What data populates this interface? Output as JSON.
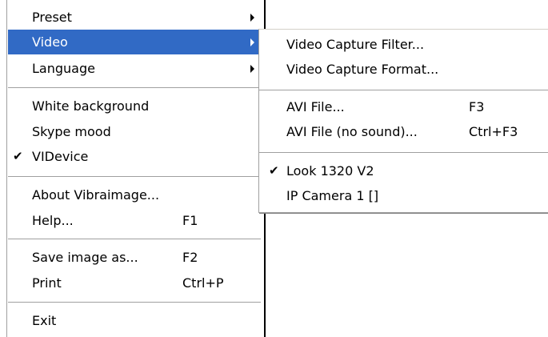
{
  "main_menu": {
    "items": [
      {
        "label": "Preset",
        "shortcut": "",
        "submenu": true
      },
      {
        "label": "Video",
        "shortcut": "",
        "submenu": true,
        "selected": true
      },
      {
        "label": "Language",
        "shortcut": "",
        "submenu": true
      },
      {
        "label": "White background",
        "shortcut": ""
      },
      {
        "label": "Skype mood",
        "shortcut": ""
      },
      {
        "label": "VIDevice",
        "shortcut": "",
        "checked": true
      },
      {
        "label": "About Vibraimage...",
        "shortcut": ""
      },
      {
        "label": "Help...",
        "shortcut": "F1"
      },
      {
        "label": "Save image as...",
        "shortcut": "F2"
      },
      {
        "label": "Print",
        "shortcut": "Ctrl+P"
      },
      {
        "label": "Exit",
        "shortcut": ""
      }
    ]
  },
  "sub_menu": {
    "items": [
      {
        "label": "Video Capture Filter...",
        "shortcut": ""
      },
      {
        "label": "Video Capture Format...",
        "shortcut": ""
      },
      {
        "label": "AVI File...",
        "shortcut": "F3"
      },
      {
        "label": "AVI File (no sound)...",
        "shortcut": "Ctrl+F3"
      },
      {
        "label": "Look 1320 V2",
        "shortcut": "",
        "checked": true
      },
      {
        "label": "IP Camera 1 []",
        "shortcut": ""
      }
    ]
  },
  "check_glyph": "✔",
  "colors": {
    "selection_bg": "#316ac5",
    "selection_fg": "#ffffff",
    "separator": "#a0a0a0"
  }
}
